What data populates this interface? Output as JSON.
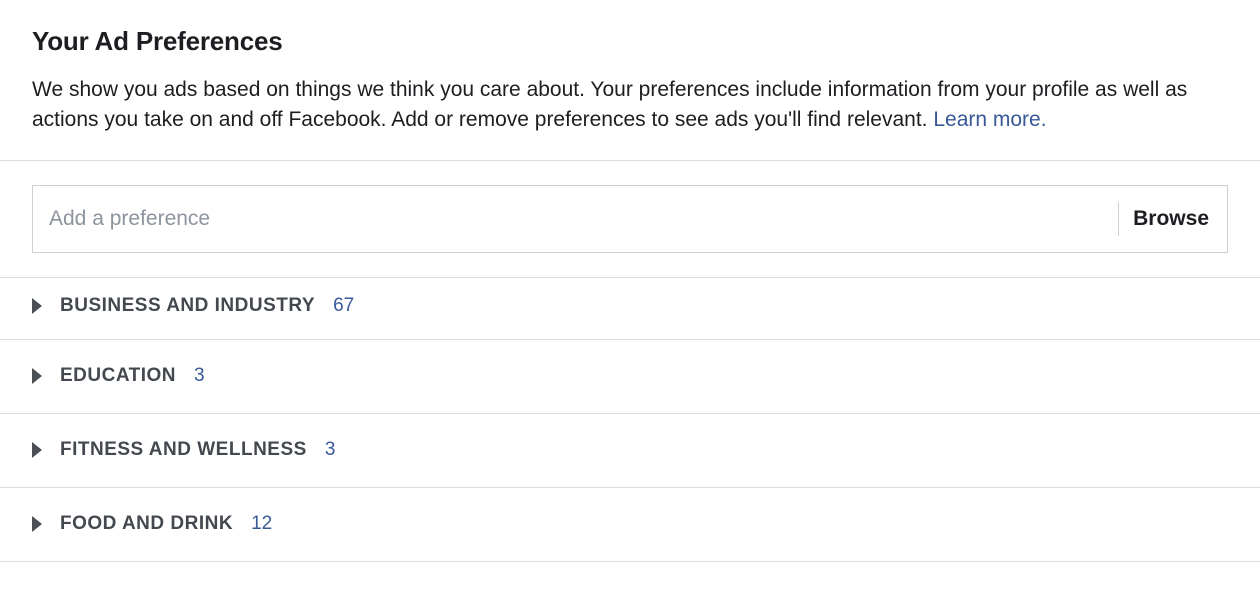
{
  "header": {
    "title": "Your Ad Preferences",
    "description_part1": "We show you ads based on things we think you care about. Your preferences include information from your profile as well as actions you take on and off Facebook. Add or remove preferences to see ads you'll find relevant. ",
    "learn_more_label": "Learn more."
  },
  "search": {
    "placeholder": "Add a preference",
    "browse_label": "Browse"
  },
  "categories": [
    {
      "label": "BUSINESS AND INDUSTRY",
      "count": "67"
    },
    {
      "label": "EDUCATION",
      "count": "3"
    },
    {
      "label": "FITNESS AND WELLNESS",
      "count": "3"
    },
    {
      "label": "FOOD AND DRINK",
      "count": "12"
    }
  ]
}
